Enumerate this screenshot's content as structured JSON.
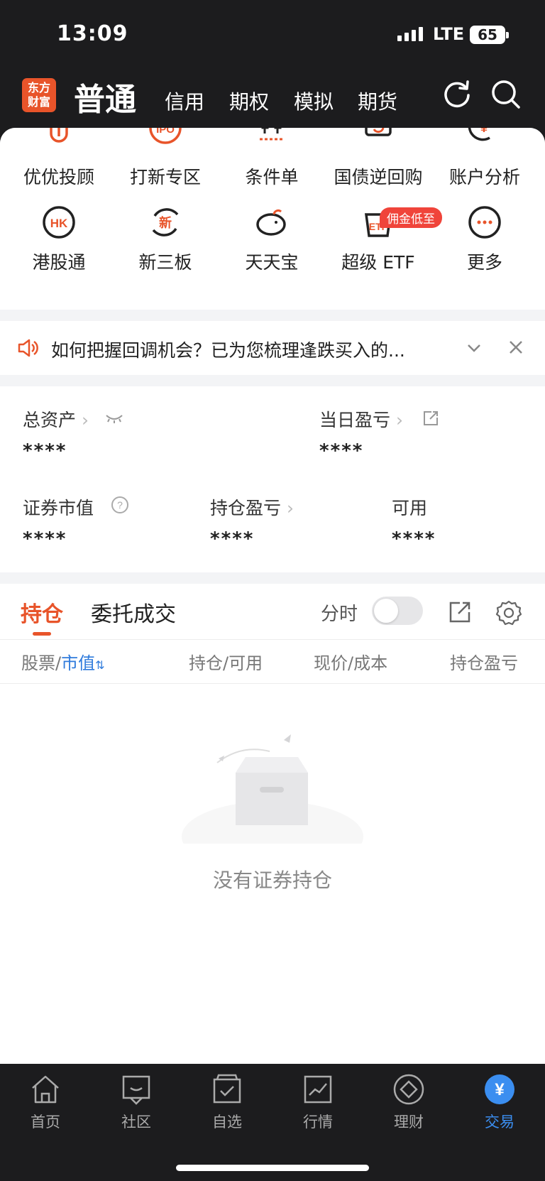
{
  "status_bar": {
    "time": "13:09",
    "network": "LTE",
    "battery": "65"
  },
  "top_nav": {
    "logo_line1": "东方",
    "logo_line2": "财富",
    "active_tab": "普通",
    "tabs": [
      "信用",
      "期权",
      "模拟",
      "期货"
    ]
  },
  "quick_grid": {
    "row1": [
      "优优投顾",
      "打新专区",
      "条件单",
      "国债逆回购",
      "账户分析"
    ],
    "row2": [
      "港股通",
      "新三板",
      "天天宝",
      "超级 ETF",
      "更多"
    ],
    "badge": "佣金低至",
    "icon_texts": {
      "ipo": "IPO",
      "hk": "HK",
      "new": "新",
      "etf": "ETF"
    }
  },
  "notice": {
    "text": "如何把握回调机会？已为您梳理逢跌买入的..."
  },
  "assets": {
    "total_label": "总资产",
    "daily_pl_label": "当日盈亏",
    "market_value_label": "证券市值",
    "position_pl_label": "持仓盈亏",
    "available_label": "可用",
    "total_value": "****",
    "daily_pl_value": "****",
    "market_value": "****",
    "position_pl_value": "****",
    "available_value": "****"
  },
  "holdings": {
    "tab_active": "持仓",
    "tab_other": "委托成交",
    "fenshi_label": "分时",
    "col_stock": "股票",
    "col_sep": "/",
    "col_market_value": "市值",
    "col_position": "持仓/可用",
    "col_price": "现价/成本",
    "col_pl": "持仓盈亏",
    "empty_text": "没有证券持仓"
  },
  "tabbar": {
    "items": [
      "首页",
      "社区",
      "自选",
      "行情",
      "理财",
      "交易"
    ],
    "trade_icon_text": "¥",
    "active_color": "#3b8ef0"
  },
  "colors": {
    "accent": "#e8542a",
    "blue": "#2f7bdc",
    "dark": "#1c1c1e"
  }
}
